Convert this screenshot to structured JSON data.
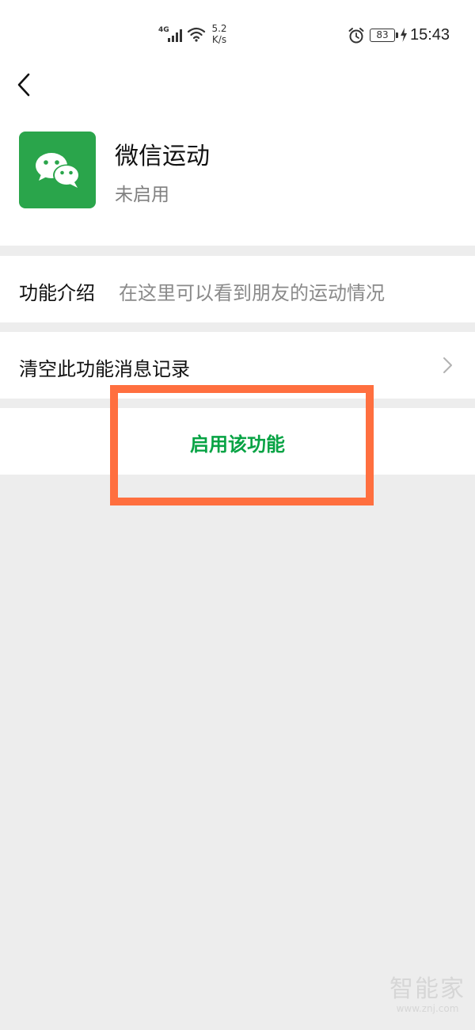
{
  "status_bar": {
    "network_type": "4G",
    "speed_value": "5.2",
    "speed_unit": "K/s",
    "battery_level": "83",
    "time": "15:43",
    "icons": [
      "signal-icon",
      "wifi-icon",
      "alarm-icon",
      "battery-icon",
      "charging-icon"
    ]
  },
  "header": {
    "back_icon": "chevron-left-icon"
  },
  "app": {
    "name": "微信运动",
    "status": "未启用",
    "icon": "wechat-icon",
    "icon_color": "#2aa54b"
  },
  "intro": {
    "label": "功能介绍",
    "text": "在这里可以看到朋友的运动情况"
  },
  "clear_history": {
    "label": "清空此功能消息记录",
    "icon": "chevron-right-icon"
  },
  "enable": {
    "label": "启用该功能",
    "color": "#07a344"
  },
  "annotation": {
    "highlight_color": "#ff6f3f"
  },
  "watermark": {
    "main": "智能家",
    "sub": "www.znj.com"
  }
}
